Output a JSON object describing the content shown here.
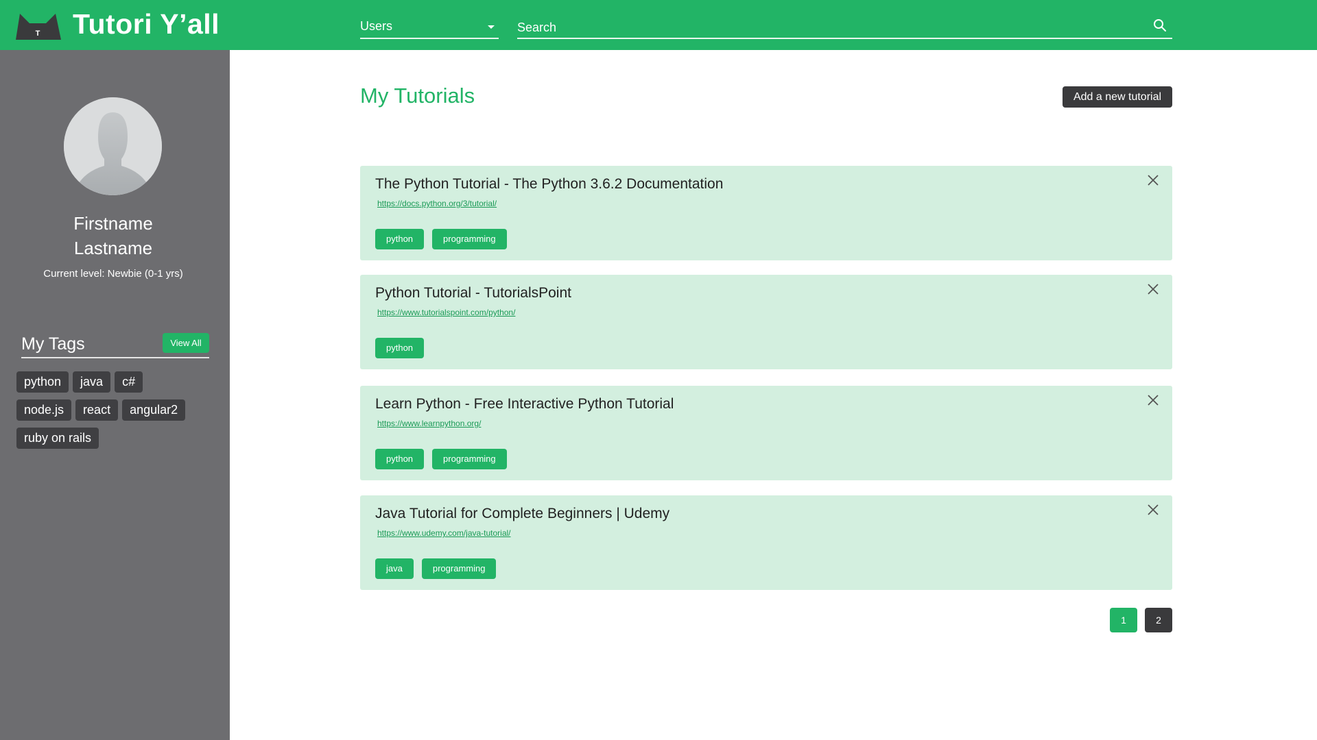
{
  "header": {
    "brand": "Tutori Y’all",
    "logo_icon": "cat-logo-icon",
    "logo_letter": "T",
    "category_select": {
      "selected": "Users"
    },
    "search": {
      "placeholder": "Search",
      "value": ""
    }
  },
  "sidebar": {
    "avatar_icon": "user-silhouette-icon",
    "first_name": "Firstname",
    "last_name": "Lastname",
    "level": "Current level: Newbie (0-1 yrs)",
    "tags_title": "My Tags",
    "view_all_label": "View All",
    "tags": [
      "python",
      "java",
      "c#",
      "node.js",
      "react",
      "angular2",
      "ruby on rails"
    ]
  },
  "main": {
    "title": "My Tutorials",
    "add_button_label": "Add a new tutorial",
    "tutorials": [
      {
        "title": "The Python Tutorial - The Python 3.6.2 Documentation",
        "url": "https://docs.python.org/3/tutorial/",
        "tags": [
          "python",
          "programming"
        ]
      },
      {
        "title": "Python Tutorial - TutorialsPoint",
        "url": "https://www.tutorialspoint.com/python/",
        "tags": [
          "python"
        ]
      },
      {
        "title": "Learn Python - Free Interactive Python Tutorial",
        "url": "https://www.learnpython.org/",
        "tags": [
          "python",
          "programming"
        ]
      },
      {
        "title": "Java Tutorial for Complete Beginners | Udemy",
        "url": "https://www.udemy.com/java-tutorial/",
        "tags": [
          "java",
          "programming"
        ]
      }
    ],
    "pagination": {
      "pages": [
        "1",
        "2"
      ],
      "current": "1"
    }
  },
  "colors": {
    "brand_green": "#22b466",
    "card_background": "#d3efdf",
    "sidebar_background": "#6d6d70",
    "dark_button": "#3a3a3c"
  }
}
